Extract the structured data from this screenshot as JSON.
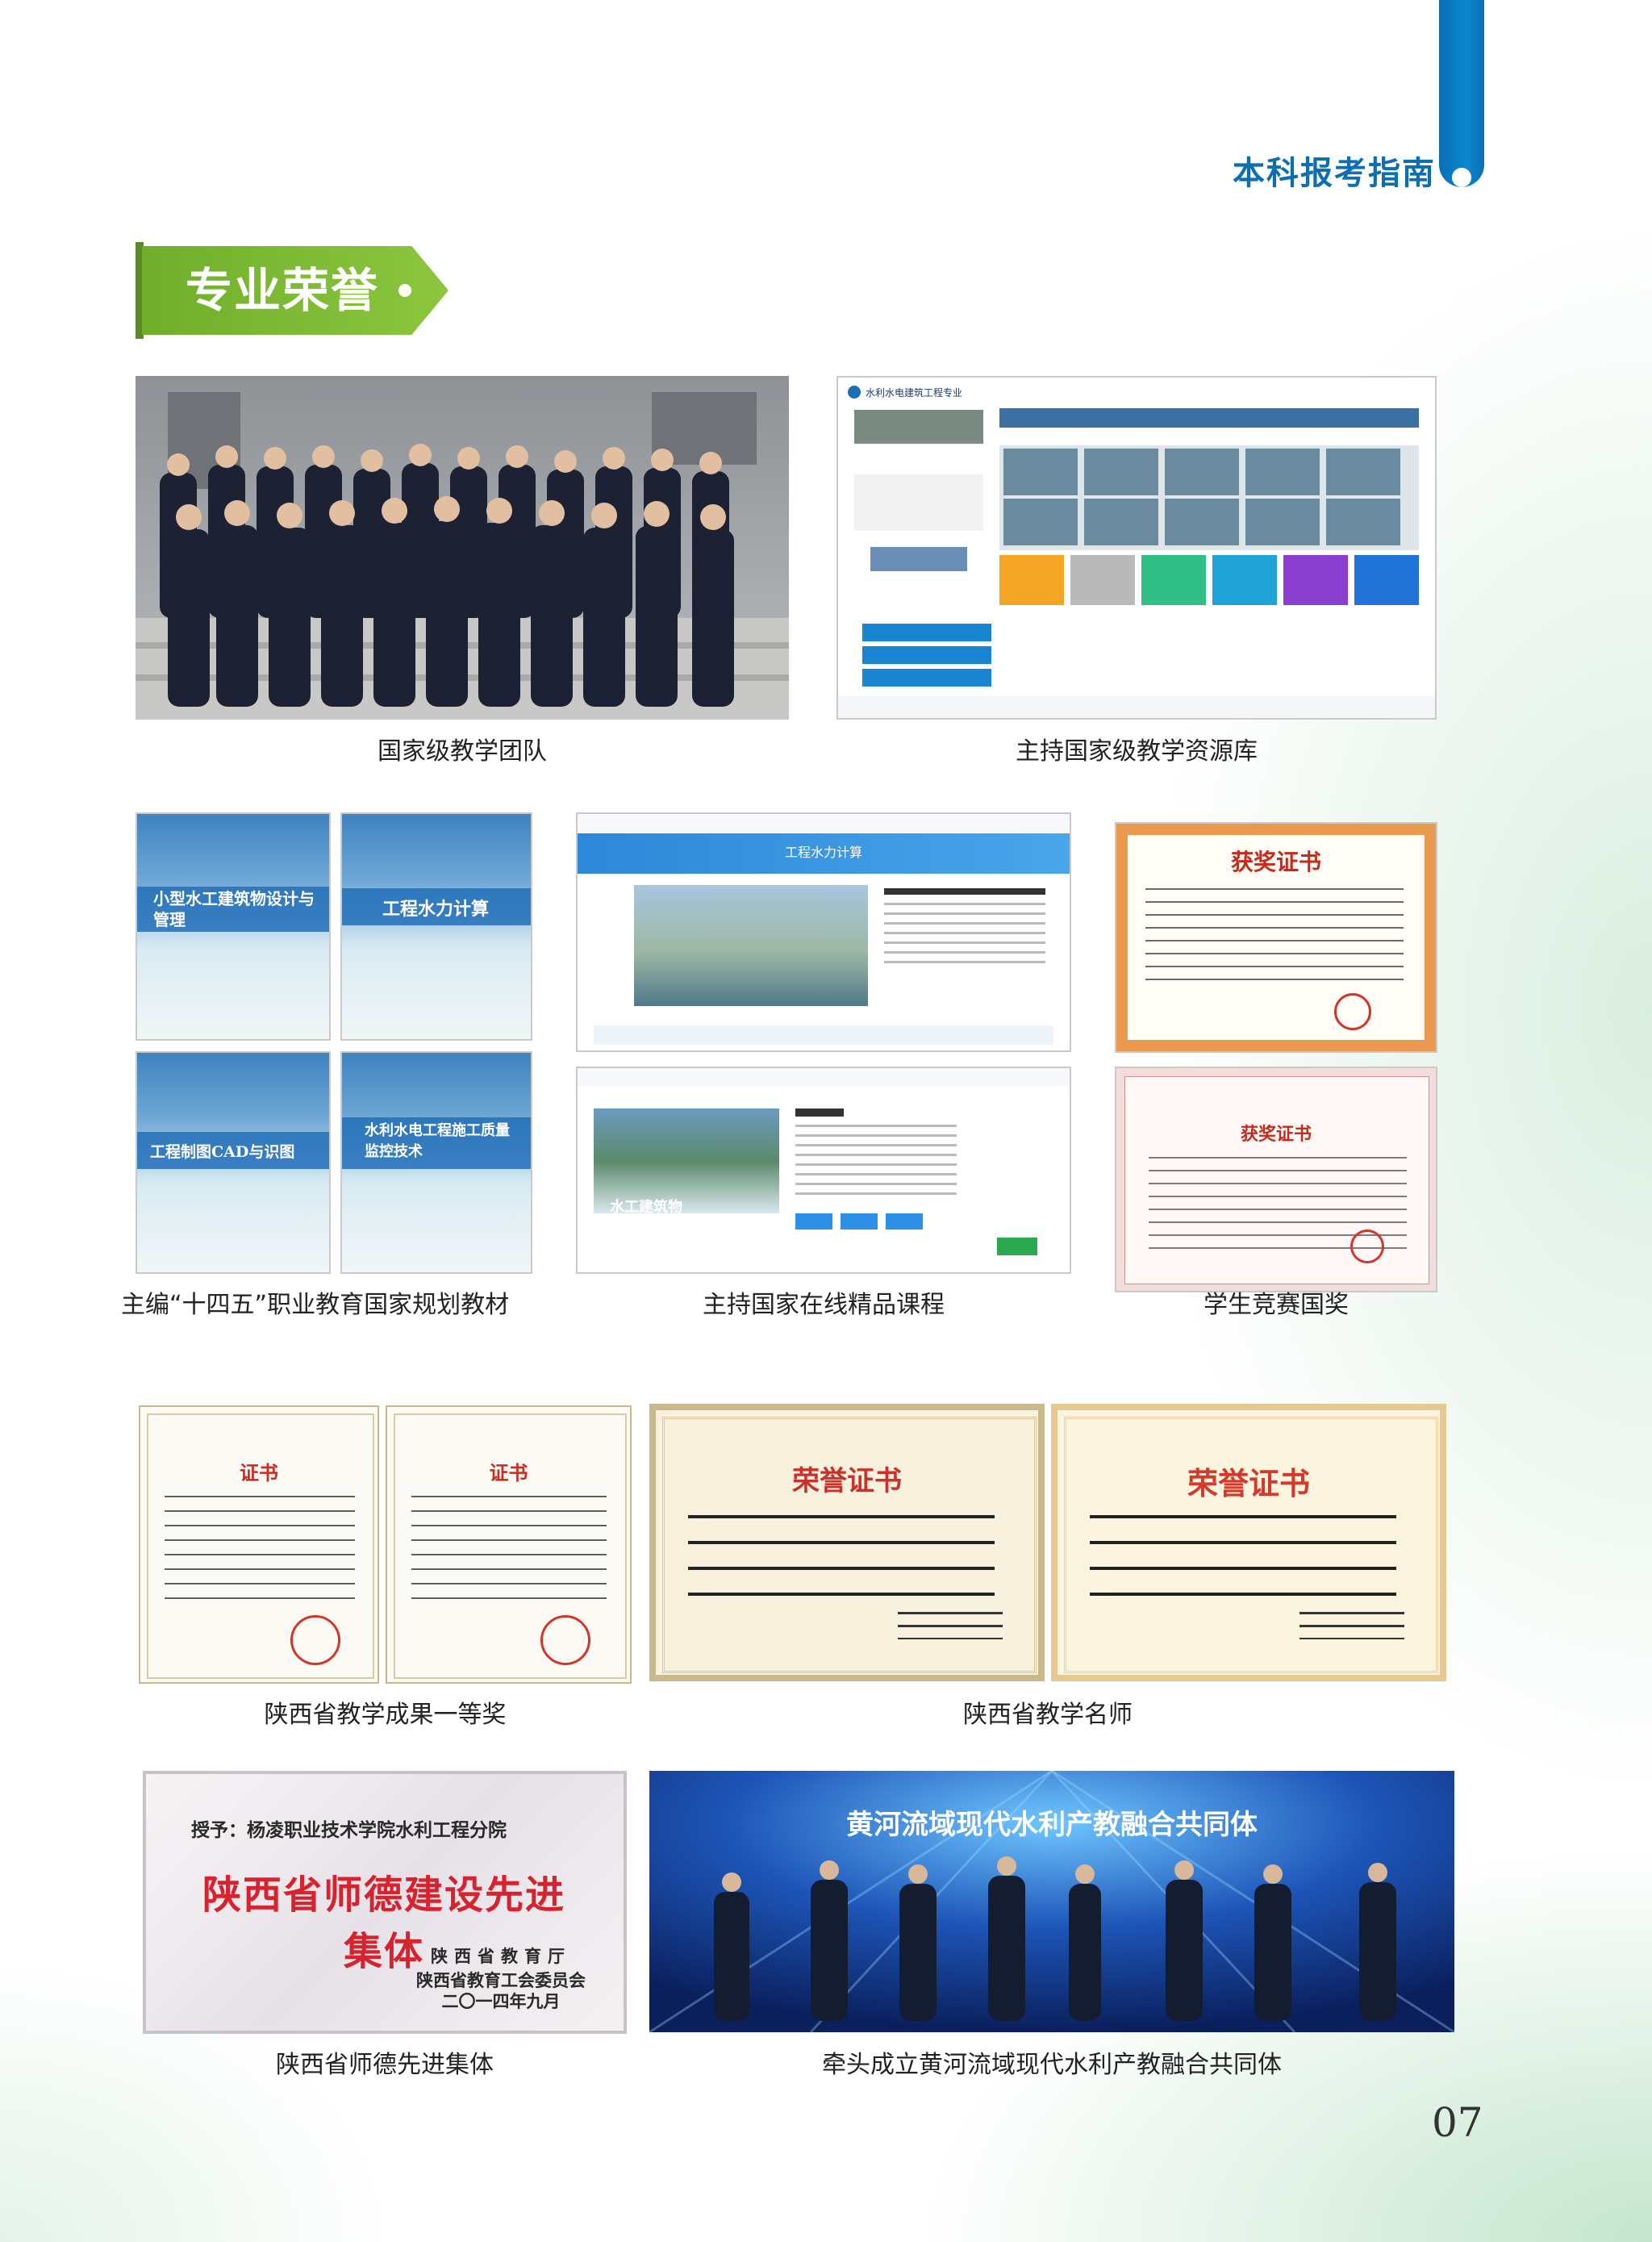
{
  "header": {
    "title": "本科报考指南"
  },
  "section": {
    "title": "专业荣誉"
  },
  "captions": {
    "team": "国家级教学团队",
    "resource": "主持国家级教学资源库",
    "textbook": "主编“十四五”职业教育国家规划教材",
    "course": "主持国家在线精品课程",
    "competition": "学生竞赛国奖",
    "achievement": "陕西省教学成果一等奖",
    "teacher": "陕西省教学名师",
    "ethics": "陕西省师德先进集体",
    "alliance": "牵头成立黄河流域现代水利产教融合共同体"
  },
  "images": {
    "resource_site": "水利水电建筑工程专业",
    "book1": "小型水工建筑物设计与管理",
    "book2": "工程水力计算",
    "book3": "工程制图CAD与识图",
    "book4": "水利水电工程施工质量监控技术",
    "course1": "工程水力计算",
    "course2": "水工建筑物",
    "cert_award1": "获奖证书",
    "cert_award2": "获奖证书",
    "cert_honor1": "荣誉证书",
    "cert_honor2": "荣誉证书",
    "cert_result1": "证书",
    "cert_result2": "证书",
    "plaque_to": "授予：杨凌职业技术学院水利工程分院",
    "plaque_title": "陕西省师德建设先进集体",
    "plaque_org1": "陕西省教育厅",
    "plaque_org2": "陕西省教育工会委员会",
    "plaque_date": "二〇一四年九月",
    "stage_banner": "黄河流域现代水利产教融合共同体"
  },
  "page": {
    "number": "07"
  }
}
